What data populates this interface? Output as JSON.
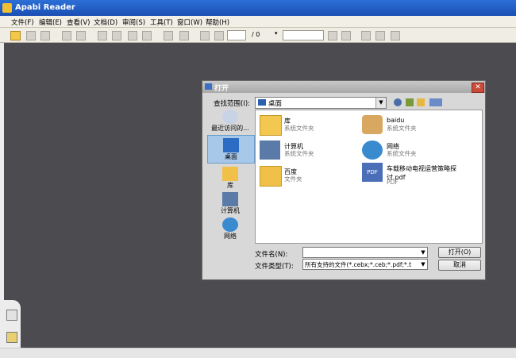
{
  "window": {
    "title": "Apabi Reader"
  },
  "menu": [
    {
      "label": "文件(F)"
    },
    {
      "label": "编辑(E)"
    },
    {
      "label": "查看(V)"
    },
    {
      "label": "文档(D)"
    },
    {
      "label": "审阅(S)"
    },
    {
      "label": "工具(T)"
    },
    {
      "label": "窗口(W)"
    },
    {
      "label": "帮助(H)"
    }
  ],
  "toolbar": {
    "page_input": "",
    "page_total": "/ 0",
    "zoom_value": ""
  },
  "dialog": {
    "title": "打开",
    "close_glyph": "✕",
    "look_in_label": "查找范围(I):",
    "look_in_value": "桌面",
    "places": [
      {
        "label": "最近访问的..."
      },
      {
        "label": "桌面"
      },
      {
        "label": "库"
      },
      {
        "label": "计算机"
      },
      {
        "label": "网络"
      }
    ],
    "files": [
      {
        "name": "库",
        "sub": "系统文件夹"
      },
      {
        "name": "baidu",
        "sub": "系统文件夹"
      },
      {
        "name": "计算机",
        "sub": "系统文件夹"
      },
      {
        "name": "网络",
        "sub": "系统文件夹"
      },
      {
        "name": "百度",
        "sub": "文件夹"
      },
      {
        "name": "车载移动电视运营策略探讨.pdf",
        "sub": "PDF"
      }
    ],
    "filename_label": "文件名(N):",
    "filename_value": "",
    "filetype_label": "文件类型(T):",
    "filetype_value": "所有支持的文件(*.cebx;*.ceb;*.pdf;*.t",
    "open_button": "打开(O)",
    "cancel_button": "取消"
  }
}
